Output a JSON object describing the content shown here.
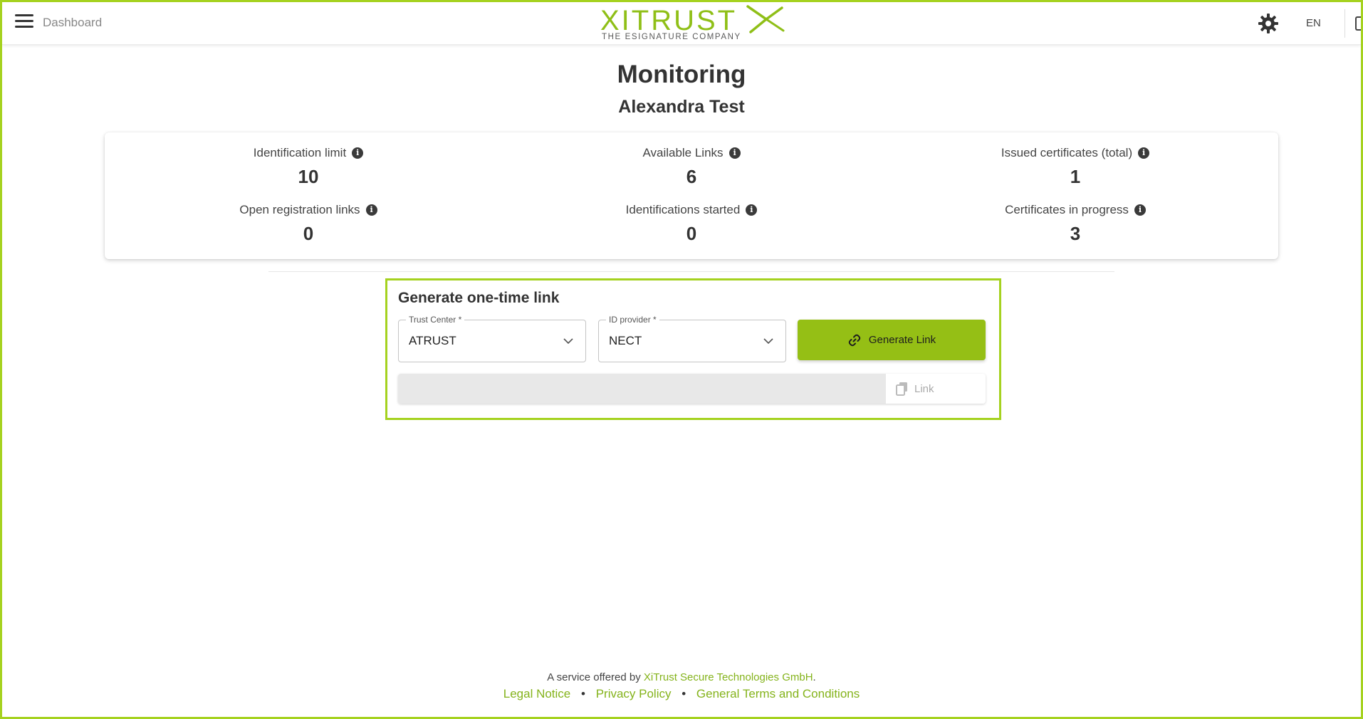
{
  "header": {
    "breadcrumb": "Dashboard",
    "logo_text": "XITRUST",
    "logo_tagline": "THE ESIGNATURE COMPANY",
    "language": "EN"
  },
  "page": {
    "title": "Monitoring",
    "subtitle": "Alexandra Test"
  },
  "stats": [
    {
      "label": "Identification limit",
      "value": "10"
    },
    {
      "label": "Available Links",
      "value": "6"
    },
    {
      "label": "Issued certificates (total)",
      "value": "1"
    },
    {
      "label": "Open registration links",
      "value": "0"
    },
    {
      "label": "Identifications started",
      "value": "0"
    },
    {
      "label": "Certificates in progress",
      "value": "3"
    }
  ],
  "generate": {
    "title": "Generate one-time link",
    "trust_center_label": "Trust Center *",
    "trust_center_value": "ATRUST",
    "id_provider_label": "ID provider *",
    "id_provider_value": "NECT",
    "generate_button": "Generate Link",
    "link_value": "",
    "copy_button": "Link"
  },
  "footer": {
    "service_prefix": "A service offered by",
    "company": "XiTrust Secure Technologies GmbH",
    "period": ".",
    "links": [
      "Legal Notice",
      "Privacy Policy",
      "General Terms and Conditions"
    ]
  },
  "colors": {
    "accent": "#95bf15",
    "frame": "#a5d21f",
    "link": "#84b31b"
  },
  "icons": [
    "menu-icon",
    "settings-gear-icon",
    "info-icon",
    "chevron-down-icon",
    "link-icon",
    "copy-icon"
  ]
}
